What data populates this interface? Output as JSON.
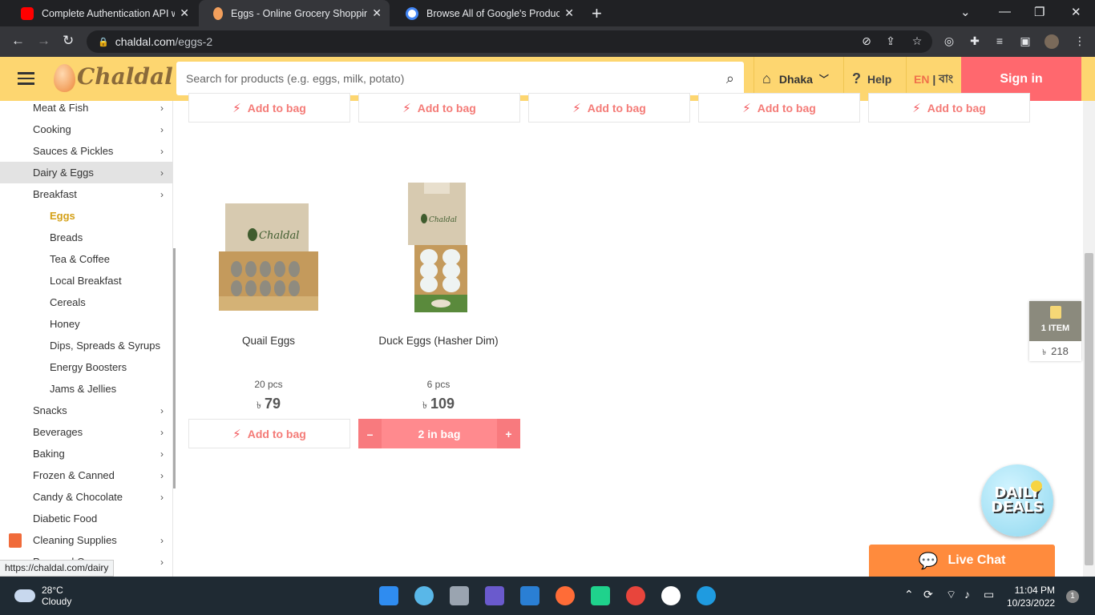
{
  "browser": {
    "tabs": [
      {
        "title": "Complete Authentication API wit",
        "favicon": "youtube-icon",
        "color": "#ff0000"
      },
      {
        "title": "Eggs - Online Grocery Shopping",
        "favicon": "chaldal-egg-icon",
        "color": "#f29f5c"
      },
      {
        "title": "Browse All of Google's Products",
        "favicon": "google-icon",
        "color": "#4285f4"
      }
    ],
    "url_host": "chaldal.com",
    "url_path": "/eggs-2",
    "status_url": "https://chaldal.com/dairy"
  },
  "header": {
    "logo_text": "Chaldal",
    "search_placeholder": "Search for products (e.g. eggs, milk, potato)",
    "area": "Dhaka",
    "help": "Help",
    "lang_en": "EN",
    "lang_sep": " | ",
    "lang_bn": "বাং",
    "signin": "Sign in"
  },
  "sidebar": {
    "items": [
      {
        "label": "Meat & Fish",
        "chevron": true
      },
      {
        "label": "Cooking",
        "chevron": true
      },
      {
        "label": "Sauces & Pickles",
        "chevron": true
      },
      {
        "label": "Dairy & Eggs",
        "chevron": true
      },
      {
        "label": "Breakfast",
        "chevron": true
      },
      {
        "label": "Eggs"
      },
      {
        "label": "Breads"
      },
      {
        "label": "Tea & Coffee"
      },
      {
        "label": "Local Breakfast"
      },
      {
        "label": "Cereals"
      },
      {
        "label": "Honey"
      },
      {
        "label": "Dips, Spreads & Syrups"
      },
      {
        "label": "Energy Boosters"
      },
      {
        "label": "Jams & Jellies"
      },
      {
        "label": "Snacks",
        "chevron": true
      },
      {
        "label": "Beverages",
        "chevron": true
      },
      {
        "label": "Baking",
        "chevron": true
      },
      {
        "label": "Frozen & Canned",
        "chevron": true
      },
      {
        "label": "Candy & Chocolate",
        "chevron": true
      },
      {
        "label": "Diabetic Food"
      },
      {
        "label": "Cleaning Supplies",
        "chevron": true
      },
      {
        "label": "Personal Care",
        "chevron": true
      }
    ]
  },
  "main": {
    "add_label": "Add to bag",
    "products": [
      {
        "name": "Quail Eggs",
        "size": "20 pcs",
        "currency": "৳",
        "price": "79"
      },
      {
        "name": "Duck Eggs (Hasher Dim)",
        "size": "6 pcs",
        "currency": "৳",
        "price": "109",
        "in_bag": "2 in bag",
        "minus": "–",
        "plus": "+"
      }
    ]
  },
  "cart": {
    "items": "1 ITEM",
    "currency": "৳",
    "total": "218"
  },
  "widgets": {
    "deals_line1": "DAILY",
    "deals_line2": "DEALS",
    "live_chat": "Live Chat"
  },
  "taskbar": {
    "temp": "28°C",
    "weather": "Cloudy",
    "time": "11:04 PM",
    "date": "10/23/2022",
    "notifications": "1"
  },
  "colors": {
    "brand_yellow": "#fdd670",
    "signin_red": "#ff686e",
    "accent_orange": "#ff8b3d"
  }
}
